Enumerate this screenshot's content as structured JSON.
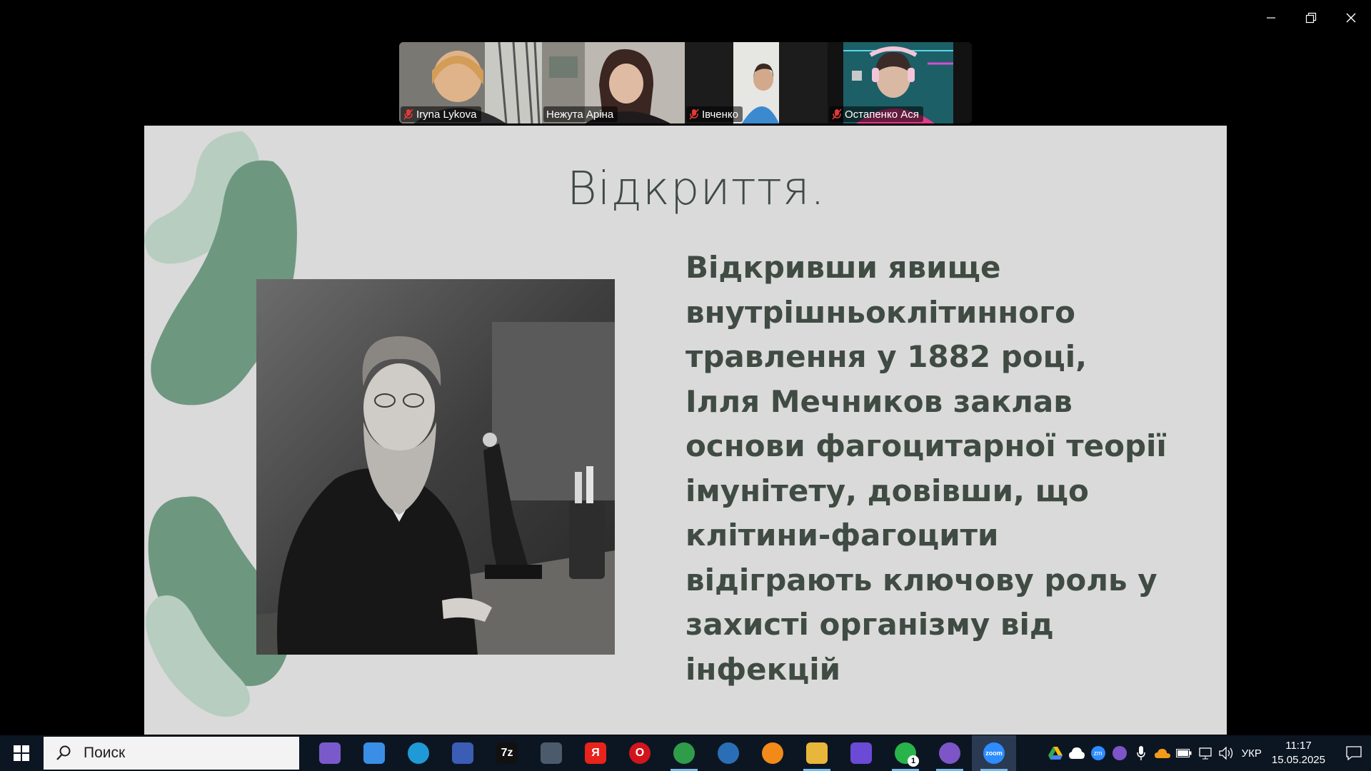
{
  "window": {
    "minimize": "minimize",
    "restore": "restore",
    "close": "close"
  },
  "participants": [
    {
      "name": "Iryna Lykova",
      "muted": true
    },
    {
      "name": "Нежута Аріна",
      "muted": false
    },
    {
      "name": "Івченко",
      "muted": true
    },
    {
      "name": "Остапенко Ася",
      "muted": true
    }
  ],
  "slide": {
    "title": "Відкриття.",
    "body": "Відкривши явище внутрішньоклітинного травлення у 1882 році, Ілля Мечников заклав основи фагоцитарної теорії імунітету, довівши, що клітини-фагоцити відіграють ключову роль у захисті організму від інфекцій",
    "accent_color": "#6e9780",
    "light_accent": "#b6cdbf",
    "text_color": "#3f4b43"
  },
  "taskbar": {
    "search_placeholder": "Поиск",
    "apps": [
      {
        "icon": "winrar-icon",
        "color": "#7a5acb",
        "label": ""
      },
      {
        "icon": "copilot-icon",
        "color": "#3a8ee6",
        "label": ""
      },
      {
        "icon": "edge-icon",
        "color": "#1f9ad6",
        "label": ""
      },
      {
        "icon": "floppy-icon",
        "color": "#3c5db5",
        "label": ""
      },
      {
        "icon": "7zip-icon",
        "color": "#111111",
        "label": "7z"
      },
      {
        "icon": "calculator-icon",
        "color": "#4c5b6c",
        "label": ""
      },
      {
        "icon": "yandex-icon",
        "color": "#e8231b",
        "label": "Я"
      },
      {
        "icon": "opera-icon",
        "color": "#d1151c",
        "label": "O"
      },
      {
        "icon": "chrome-icon",
        "color": "#2f9c4a",
        "label": ""
      },
      {
        "icon": "blue-orb-icon",
        "color": "#2a6fb6",
        "label": ""
      },
      {
        "icon": "network-app-icon",
        "color": "#f28a1a",
        "label": ""
      },
      {
        "icon": "file-explorer-icon",
        "color": "#e8b63a",
        "label": ""
      },
      {
        "icon": "purple-app-icon",
        "color": "#6b4ad6",
        "label": ""
      },
      {
        "icon": "whatsapp-icon",
        "color": "#29b34b",
        "label": "",
        "badge": "1"
      },
      {
        "icon": "viber-icon",
        "color": "#7d55c7",
        "label": ""
      },
      {
        "icon": "zoom-icon",
        "color": "#2d8cff",
        "label": "zoom",
        "active": true
      }
    ],
    "language": "УКР",
    "time": "11:17",
    "date": "15.05.2025"
  }
}
